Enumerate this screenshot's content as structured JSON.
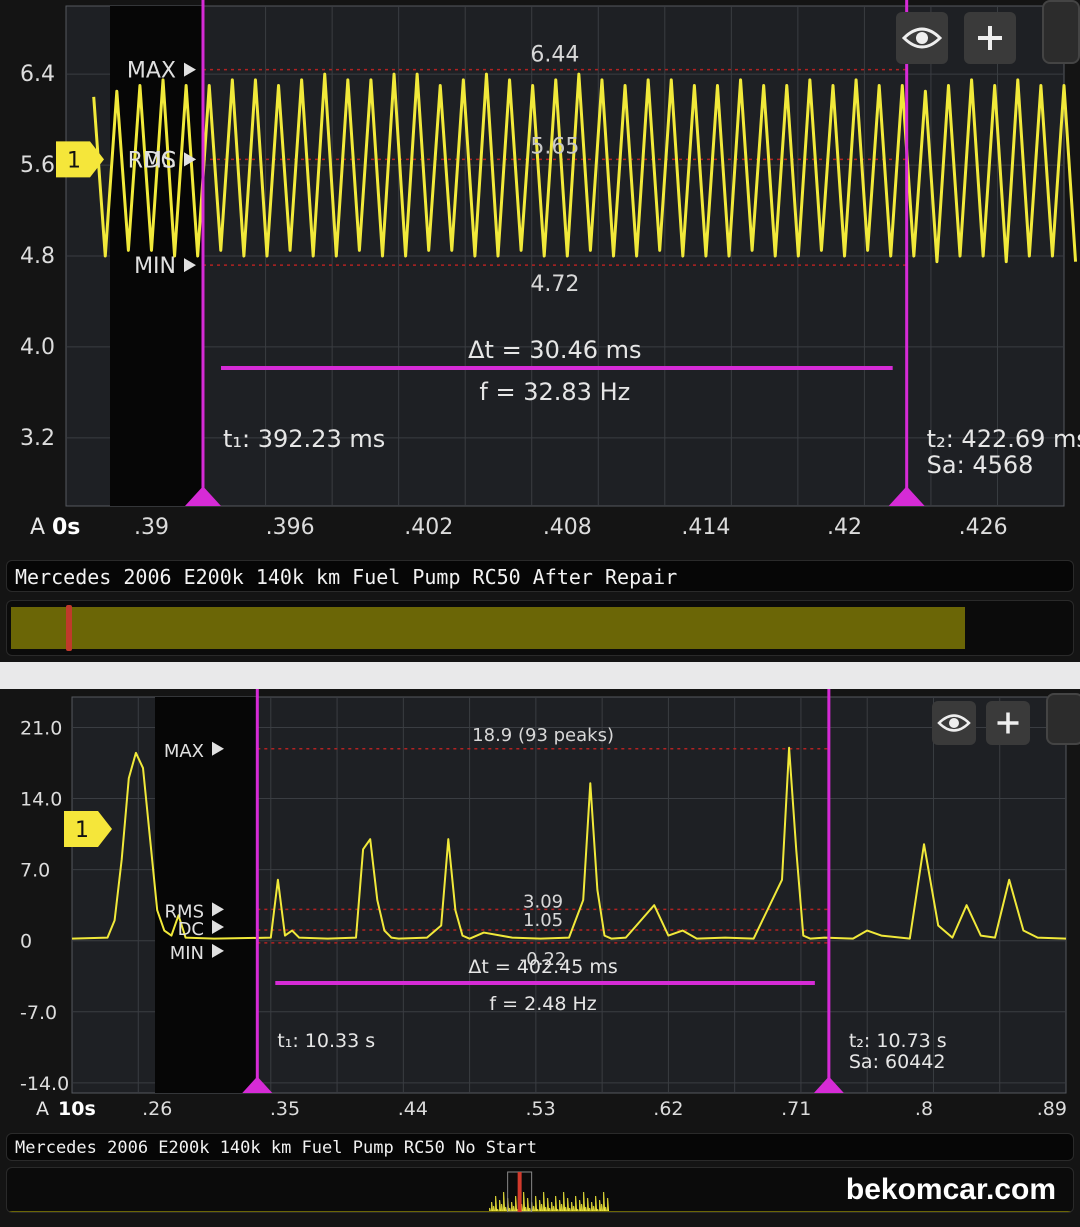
{
  "colors": {
    "trace": "#f1e93a",
    "cursor": "#d62bd6",
    "grid": "#3a3d42",
    "plot_bg": "#1e2024",
    "level_line": "#b22222"
  },
  "icons": {
    "visibility": "eye-icon",
    "add": "plus-icon"
  },
  "watermark": "bekomcar.com",
  "top_panel": {
    "title": "Mercedes 2006 E200k 140k km Fuel Pump RC50 After Repair",
    "channel_badge": "1",
    "channel_letter": "A",
    "time_offset": "0s",
    "max_label": "MAX",
    "rms_label": "RMS",
    "dc_label": "DC",
    "min_label": "MIN",
    "max_value": "6.44",
    "mid_value": "5.65",
    "min_value": "4.72",
    "delta_t": "Δt = 30.46 ms",
    "frequency": "f = 32.83 Hz",
    "t1": "t₁: 392.23 ms",
    "t2": "t₂: 422.69 ms",
    "samples": "Sa: 4568",
    "overview_fill_fraction": 0.9,
    "overview_marker_fraction": 0.055
  },
  "bottom_panel": {
    "title": "Mercedes 2006 E200k 140k km Fuel Pump RC50 No Start",
    "channel_badge": "1",
    "channel_letter": "A",
    "time_offset": "10s",
    "max_label": "MAX",
    "rms_label": "RMS",
    "dc_label": "DC",
    "min_label": "MIN",
    "max_value": "18.9 (93 peaks)",
    "rms_value": "3.09",
    "dc_value": "1.05",
    "min_value": "-0.22",
    "delta_t": "Δt = 402.45 ms",
    "frequency": "f = 2.48 Hz",
    "t1": "t₁: 10.33 s",
    "t2": "t₂: 10.73 s",
    "samples": "Sa: 60442",
    "overview_marker_fraction": 0.48
  },
  "chart_data": [
    {
      "type": "line",
      "title": "",
      "series": [
        {
          "values_description_omitted": true,
          "x": [
            0.3875,
            0.3885,
            0.3895,
            0.3905,
            0.3915,
            0.3925,
            0.3935,
            0.3945,
            0.3955,
            0.3965,
            0.3975,
            0.3985,
            0.3995,
            0.4005,
            0.4015,
            0.4025,
            0.4035,
            0.4045,
            0.4055,
            0.4065,
            0.4075,
            0.4085,
            0.4095,
            0.4105,
            0.4115,
            0.4125,
            0.4135,
            0.4145,
            0.4155,
            0.4165,
            0.4175,
            0.4185,
            0.4195,
            0.4205,
            0.4215,
            0.4225,
            0.4235,
            0.4245,
            0.4255,
            0.4265,
            0.4275,
            0.4285,
            0.4295
          ],
          "y": [
            6.2,
            6.25,
            6.3,
            6.35,
            6.3,
            6.3,
            6.35,
            6.35,
            6.3,
            6.35,
            6.4,
            6.35,
            6.35,
            6.4,
            6.4,
            6.3,
            6.35,
            6.4,
            6.35,
            6.3,
            6.35,
            6.4,
            6.35,
            6.3,
            6.35,
            6.35,
            6.3,
            6.3,
            6.35,
            6.3,
            6.3,
            6.35,
            6.3,
            6.35,
            6.3,
            6.3,
            6.25,
            6.3,
            6.35,
            6.3,
            6.35,
            6.3,
            6.3
          ]
        }
      ],
      "min_series": [
        4.8,
        4.85,
        4.85,
        4.8,
        4.8,
        4.85,
        4.8,
        4.8,
        4.85,
        4.8,
        4.8,
        4.85,
        4.8,
        4.8,
        4.85,
        4.85,
        4.8,
        4.8,
        4.85,
        4.8,
        4.8,
        4.85,
        4.8,
        4.8,
        4.85,
        4.8,
        4.8,
        4.8,
        4.85,
        4.8,
        4.8,
        4.85,
        4.8,
        4.85,
        4.8,
        4.8,
        4.75,
        4.8,
        4.8,
        4.75,
        4.8,
        4.8,
        4.75
      ],
      "xticks": [
        ".39",
        ".396",
        ".402",
        ".408",
        ".414",
        ".42",
        ".426"
      ],
      "xtick_values": [
        0.39,
        0.396,
        0.402,
        0.408,
        0.414,
        0.42,
        0.426
      ],
      "yticks": [
        "6.4",
        "5.6",
        "4.8",
        "4.0",
        "3.2"
      ],
      "ytick_values": [
        6.4,
        5.6,
        4.8,
        4.0,
        3.2
      ],
      "xlim": [
        0.3863,
        0.4295
      ],
      "ylim": [
        2.6,
        7.0
      ],
      "max_level": 6.44,
      "mid_level": 5.65,
      "min_level": 4.72,
      "cursor_t1": 0.39223,
      "cursor_t2": 0.42269,
      "grid": true
    },
    {
      "type": "line",
      "title": "",
      "series": [
        {
          "x": [
            0.2,
            0.225,
            0.23,
            0.235,
            0.24,
            0.245,
            0.25,
            0.255,
            0.26,
            0.265,
            0.27,
            0.275,
            0.28,
            0.3,
            0.34,
            0.345,
            0.35,
            0.355,
            0.36,
            0.38,
            0.4,
            0.405,
            0.41,
            0.415,
            0.42,
            0.425,
            0.43,
            0.45,
            0.46,
            0.465,
            0.47,
            0.475,
            0.48,
            0.49,
            0.51,
            0.53,
            0.55,
            0.56,
            0.565,
            0.57,
            0.575,
            0.58,
            0.59,
            0.61,
            0.62,
            0.63,
            0.64,
            0.66,
            0.68,
            0.7,
            0.705,
            0.71,
            0.715,
            0.72,
            0.73,
            0.75,
            0.76,
            0.77,
            0.79,
            0.8,
            0.81,
            0.82,
            0.83,
            0.84,
            0.85,
            0.86,
            0.87,
            0.88,
            0.9
          ],
          "y": [
            0.2,
            0.3,
            2.0,
            8.0,
            16.0,
            18.5,
            17.0,
            10.0,
            3.0,
            1.0,
            0.5,
            2.5,
            0.3,
            0.2,
            0.3,
            6.0,
            0.5,
            1.0,
            0.3,
            0.2,
            0.3,
            9.0,
            10.0,
            4.0,
            1.0,
            0.3,
            0.2,
            0.3,
            1.5,
            10.0,
            3.0,
            0.5,
            0.2,
            0.8,
            0.3,
            0.2,
            0.3,
            4.0,
            15.5,
            5.0,
            0.5,
            0.2,
            0.3,
            3.5,
            0.5,
            1.0,
            0.2,
            0.3,
            0.2,
            6.0,
            19.0,
            9.0,
            0.5,
            0.2,
            0.3,
            0.2,
            1.0,
            0.5,
            0.2,
            9.5,
            1.5,
            0.3,
            3.5,
            0.5,
            0.3,
            6.0,
            1.0,
            0.3,
            0.2
          ]
        }
      ],
      "xticks": [
        ".26",
        ".35",
        ".44",
        ".53",
        ".62",
        ".71",
        ".8",
        ".89"
      ],
      "xtick_values": [
        0.26,
        0.35,
        0.44,
        0.53,
        0.62,
        0.71,
        0.8,
        0.89
      ],
      "yticks": [
        "21.0",
        "14.0",
        "7.0",
        "0",
        "-7.0",
        "-14.0"
      ],
      "ytick_values": [
        21,
        14,
        7,
        0,
        -7,
        -14
      ],
      "xlim": [
        0.2,
        0.9
      ],
      "ylim": [
        -15,
        24
      ],
      "max_level": 18.9,
      "rms_level": 3.09,
      "dc_level": 1.05,
      "min_level": -0.22,
      "cursor_t1": 0.3305,
      "cursor_t2": 0.733,
      "grid": true
    }
  ]
}
